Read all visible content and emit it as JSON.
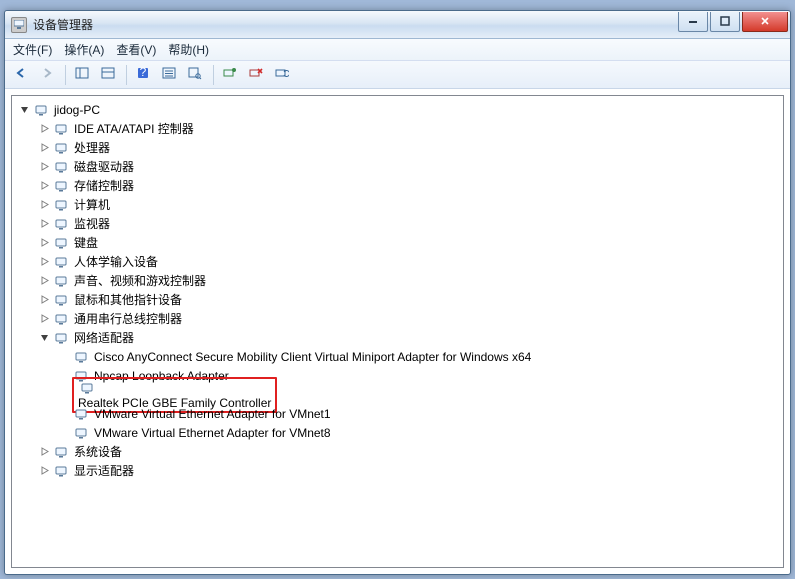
{
  "window": {
    "title": "设备管理器"
  },
  "menus": {
    "file": "文件(F)",
    "action": "操作(A)",
    "view": "查看(V)",
    "help": "帮助(H)"
  },
  "toolbar_icons": [
    {
      "name": "back-icon"
    },
    {
      "name": "forward-icon"
    },
    {
      "sep": true
    },
    {
      "name": "show-hide-tree-icon"
    },
    {
      "name": "properties-pane-icon"
    },
    {
      "sep": true
    },
    {
      "name": "help-icon"
    },
    {
      "name": "details-icon"
    },
    {
      "name": "search-icon"
    },
    {
      "sep": true
    },
    {
      "name": "scan-hardware-icon"
    },
    {
      "name": "uninstall-icon"
    },
    {
      "name": "refresh-icon"
    }
  ],
  "tree": {
    "root": {
      "label": "jidog-PC",
      "icon": "computer-root-icon",
      "expanded": true,
      "children": [
        {
          "label": "IDE ATA/ATAPI 控制器",
          "icon": "ide-controller-icon",
          "expanded": false,
          "has_children": true
        },
        {
          "label": "处理器",
          "icon": "processor-icon",
          "expanded": false,
          "has_children": true
        },
        {
          "label": "磁盘驱动器",
          "icon": "disk-drive-icon",
          "expanded": false,
          "has_children": true
        },
        {
          "label": "存储控制器",
          "icon": "storage-controller-icon",
          "expanded": false,
          "has_children": true
        },
        {
          "label": "计算机",
          "icon": "computer-icon",
          "expanded": false,
          "has_children": true
        },
        {
          "label": "监视器",
          "icon": "monitor-icon",
          "expanded": false,
          "has_children": true
        },
        {
          "label": "键盘",
          "icon": "keyboard-icon",
          "expanded": false,
          "has_children": true
        },
        {
          "label": "人体学输入设备",
          "icon": "hid-icon",
          "expanded": false,
          "has_children": true
        },
        {
          "label": "声音、视频和游戏控制器",
          "icon": "sound-icon",
          "expanded": false,
          "has_children": true
        },
        {
          "label": "鼠标和其他指针设备",
          "icon": "mouse-icon",
          "expanded": false,
          "has_children": true
        },
        {
          "label": "通用串行总线控制器",
          "icon": "usb-icon",
          "expanded": false,
          "has_children": true
        },
        {
          "label": "网络适配器",
          "icon": "network-adapters-icon",
          "expanded": true,
          "has_children": true,
          "children": [
            {
              "label": "Cisco AnyConnect Secure Mobility Client Virtual Miniport Adapter for Windows x64",
              "icon": "network-adapter-icon"
            },
            {
              "label": "Npcap Loopback Adapter",
              "icon": "network-adapter-icon"
            },
            {
              "label": "Realtek PCIe GBE Family Controller",
              "icon": "network-adapter-icon",
              "highlight": true
            },
            {
              "label": "VMware Virtual Ethernet Adapter for VMnet1",
              "icon": "network-adapter-icon"
            },
            {
              "label": "VMware Virtual Ethernet Adapter for VMnet8",
              "icon": "network-adapter-icon"
            }
          ]
        },
        {
          "label": "系统设备",
          "icon": "system-devices-icon",
          "expanded": false,
          "has_children": true
        },
        {
          "label": "显示适配器",
          "icon": "display-adapter-icon",
          "expanded": false,
          "has_children": true
        }
      ]
    }
  }
}
